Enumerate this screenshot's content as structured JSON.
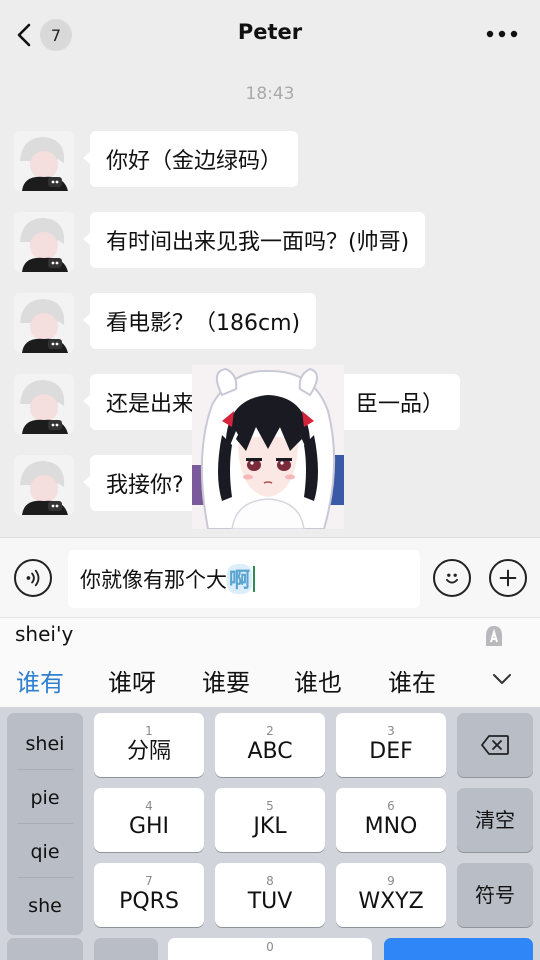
{
  "header": {
    "title": "Peter",
    "unread_count": "7",
    "back_icon": "chevron-left-icon",
    "more_icon": "ellipsis-icon"
  },
  "chat": {
    "timestamp": "18:43",
    "messages": [
      {
        "text": "你好（金边绿码）"
      },
      {
        "text": "有时间出来见我一面吗？(帅哥)"
      },
      {
        "text": "看电影？（186cm)"
      },
      {
        "text": "还是出来"
      },
      {
        "text": "我接你?"
      }
    ],
    "message_4_tail": "臣一品）"
  },
  "input": {
    "text": "你就像有那个大",
    "composing": "啊",
    "voice_icon": "voice-icon",
    "emoji_icon": "emoji-icon",
    "plus_icon": "plus-icon"
  },
  "ime": {
    "pinyin": "shei'y",
    "candidates": [
      "谁有",
      "谁呀",
      "谁要",
      "谁也",
      "谁在"
    ],
    "side_column": [
      "shei",
      "pie",
      "qie",
      "she"
    ],
    "keys": [
      {
        "num": "1",
        "label": "分隔"
      },
      {
        "num": "2",
        "label": "ABC"
      },
      {
        "num": "3",
        "label": "DEF"
      },
      {
        "num": "4",
        "label": "GHI"
      },
      {
        "num": "5",
        "label": "JKL"
      },
      {
        "num": "6",
        "label": "MNO"
      },
      {
        "num": "7",
        "label": "PQRS"
      },
      {
        "num": "8",
        "label": "TUV"
      },
      {
        "num": "9",
        "label": "WXYZ"
      },
      {
        "num": "0",
        "label": ""
      }
    ],
    "clear_label": "清空",
    "symbol_label": "符号",
    "backspace_icon": "backspace-icon",
    "collapse_icon": "chevron-down-icon"
  },
  "colors": {
    "accent": "#2f80d0",
    "chat_bg": "#ededed",
    "bubble": "#ffffff",
    "return_key": "#2f86f6"
  }
}
